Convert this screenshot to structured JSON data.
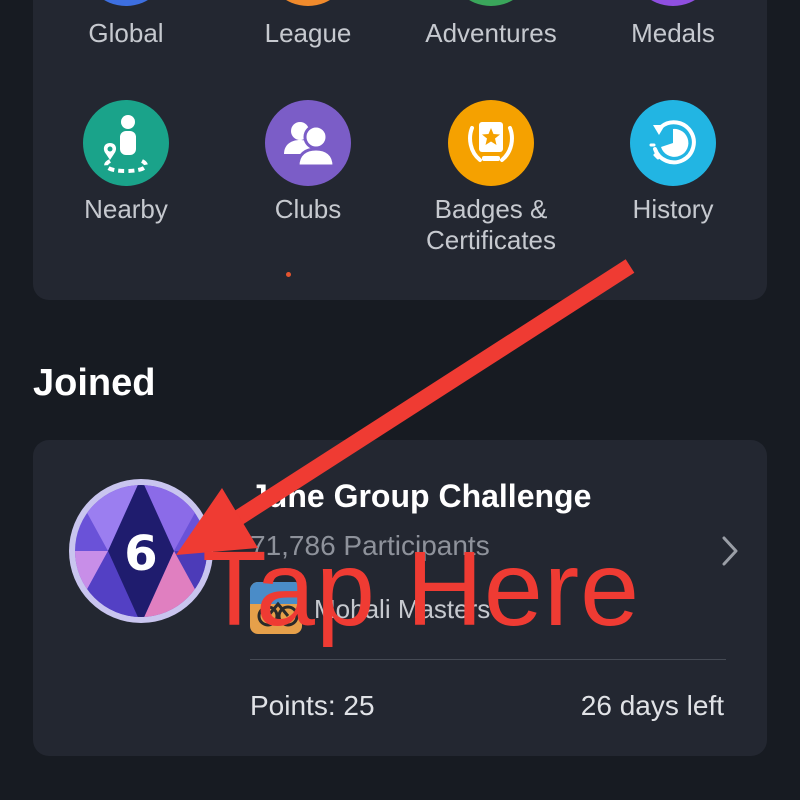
{
  "top_row": [
    "Global",
    "League",
    "Adventures",
    "Medals"
  ],
  "tiles": [
    {
      "label_lines": [
        "Nearby"
      ],
      "icon": "nearby-person-pin-icon",
      "color": "#1aa38a"
    },
    {
      "label_lines": [
        "Clubs"
      ],
      "icon": "clubs-people-icon",
      "color": "#7b5dc7"
    },
    {
      "label_lines": [
        "Badges &",
        "Certificates"
      ],
      "icon": "badge-certificate-icon",
      "color": "#f5a100"
    },
    {
      "label_lines": [
        "History"
      ],
      "icon": "history-clock-icon",
      "color": "#22b5e3"
    }
  ],
  "section_title": "Joined",
  "challenge": {
    "name": "June Group Challenge",
    "participants": "71,786 Participants",
    "club": "Mohali Masters",
    "points": "Points: 25",
    "days_left": "26 days left",
    "badge_number": "6"
  },
  "annotation": {
    "text": "Tap Here",
    "color": "#ef3b33"
  }
}
